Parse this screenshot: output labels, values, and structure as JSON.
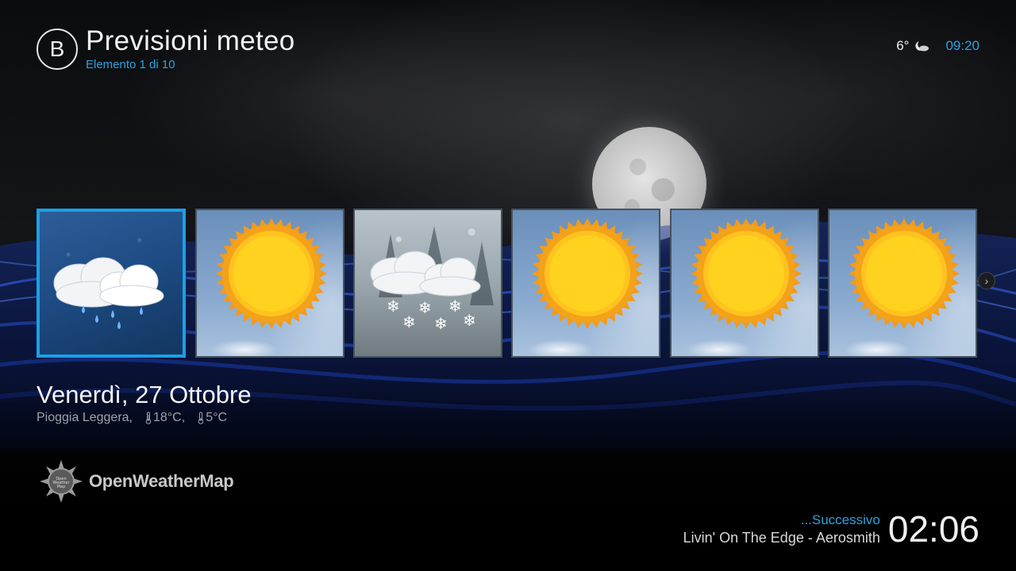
{
  "header": {
    "logo_letter": "B",
    "title": "Previsioni meteo",
    "subtitle": "Elemento 1 di 10"
  },
  "status": {
    "temperature": "6°",
    "weather_icon": "moon-cloud-icon",
    "clock": "09:20"
  },
  "forecast": {
    "tiles": [
      {
        "condition": "rain",
        "icon": "rain-cloud-icon",
        "focused": true
      },
      {
        "condition": "sunny",
        "icon": "sun-icon",
        "focused": false
      },
      {
        "condition": "snow",
        "icon": "snow-cloud-icon",
        "focused": false
      },
      {
        "condition": "sunny",
        "icon": "sun-icon",
        "focused": false
      },
      {
        "condition": "sunny",
        "icon": "sun-icon",
        "focused": false
      },
      {
        "condition": "sunny",
        "icon": "sun-icon",
        "focused": false
      }
    ],
    "next_icon": "chevron-right-icon"
  },
  "selected": {
    "day": "Venerdì, 27 Ottobre",
    "description": "Pioggia Leggera,",
    "high": "18°C,",
    "low": "5°C"
  },
  "provider": {
    "name": "OpenWeatherMap",
    "logo_text": "Open Weather Map"
  },
  "now_playing": {
    "label": "...Successivo",
    "track": "Livin' On The Edge - Aerosmith",
    "time": "02:06"
  },
  "colors": {
    "accent": "#2aa3e0",
    "focus_border": "#1aa0e8",
    "text_primary": "#f2f2f2",
    "text_secondary": "#9ea4aa"
  }
}
